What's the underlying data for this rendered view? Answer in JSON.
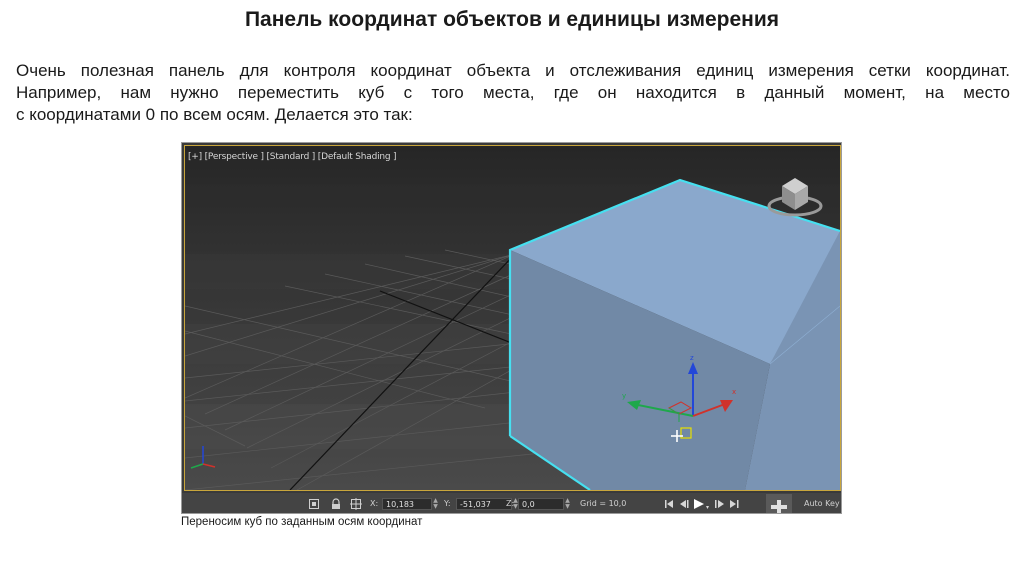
{
  "slide": {
    "title": "Панель координат объектов и единицы измерения",
    "paragraph": {
      "line1": "Очень полезная панель для контроля координат объекта и отслеживания единиц измерения сетки координат.",
      "line2": "Например, нам нужно переместить куб с того места, где он находится в данный момент, на место",
      "line3": "с координатами 0 по всем осям. Делается это так:"
    },
    "caption": "Переносим куб по заданным осям координат"
  },
  "viewport": {
    "label": "[+] [Perspective ] [Standard ] [Default Shading ]",
    "gizmo_z_label": "z",
    "gizmo_y_label": "y",
    "gizmo_x_label": "x"
  },
  "statusbar": {
    "x_label": "X:",
    "x_value": "10,183",
    "y_label": "Y:",
    "y_value": "-51,037",
    "z_label": "Z:",
    "z_value": "0,0",
    "grid_label": "Grid = 10,0",
    "auto_key_label": "Auto Key"
  },
  "colors": {
    "cube_front": "#7189a6",
    "cube_top": "#8aa8cc",
    "cube_side": "#7a94b4",
    "cube_edge": "#46e0f0",
    "viewport_bg": "#404040"
  }
}
